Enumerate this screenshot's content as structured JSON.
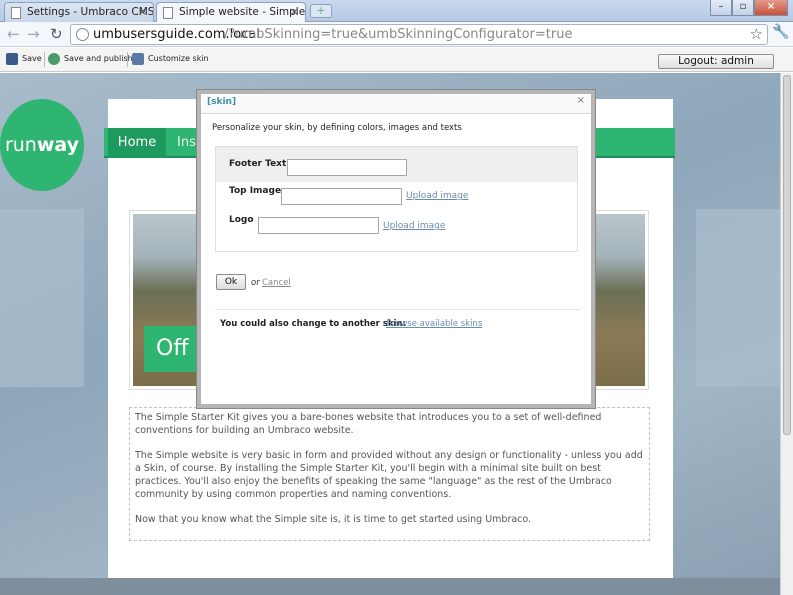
{
  "browser": {
    "tabs": [
      {
        "label": "Settings - Umbraco CMS ..."
      },
      {
        "label": "Simple website - Simple ..."
      }
    ],
    "url_host": "umbusersguide.com.local",
    "url_path": "/?umbSkinning=true&umbSkinningConfigurator=true"
  },
  "toolbar": {
    "save_label": "Save",
    "save_publish_label": "Save and publish",
    "customize_label": "Customize skin",
    "logout_label": "Logout: admin"
  },
  "site": {
    "logo": {
      "part1": "run",
      "part2": "way"
    },
    "menu": {
      "home": "Home",
      "second": "Inst"
    },
    "hero_text": "Off",
    "paragraphs": [
      "The Simple Starter Kit gives you a bare-bones website that introduces you to a set of well-defined conventions for building an Umbraco website.",
      "The Simple website is very basic in form and provided without any design or functionality - unless you add a Skin, of course. By installing the Simple Starter Kit, you'll begin with a minimal site built on best practices. You'll also enjoy the benefits of speaking the same \"language\" as the rest of the Umbraco community by using common properties and naming conventions.",
      "Now that you know what the Simple site is, it is time to get started using Umbraco."
    ]
  },
  "dialog": {
    "title": "[skin]",
    "close": "×",
    "intro": "Personalize your skin, by defining colors, images and texts",
    "fields": {
      "footer_label": "Footer Text",
      "footer_value": "",
      "top_image_label": "Top Image",
      "top_image_value": "",
      "logo_label": "Logo",
      "logo_value": "",
      "upload_label": "Upload image"
    },
    "ok_label": "Ok",
    "or_label": "or",
    "cancel_label": "Cancel",
    "change_text": "You could also change to another skin:",
    "browse_label": "Browse available skins"
  }
}
